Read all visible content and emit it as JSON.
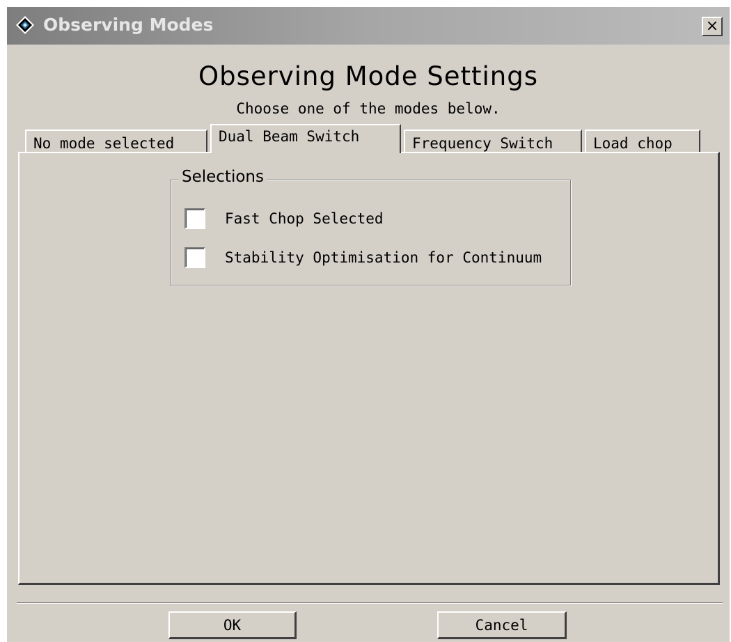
{
  "window": {
    "title": "Observing Modes",
    "close_label": "×"
  },
  "header": {
    "heading": "Observing Mode Settings",
    "subheading": "Choose one of the modes below."
  },
  "tabs": [
    {
      "label": "No mode selected",
      "active": false
    },
    {
      "label": "Dual Beam Switch",
      "active": true
    },
    {
      "label": "Frequency Switch",
      "active": false
    },
    {
      "label": "Load chop",
      "active": false
    }
  ],
  "selections": {
    "legend": "Selections",
    "options": [
      {
        "label": "Fast Chop Selected",
        "checked": false
      },
      {
        "label": "Stability Optimisation for Continuum",
        "checked": false
      }
    ]
  },
  "buttons": {
    "ok_label": "OK",
    "cancel_label": "Cancel"
  },
  "icons": {
    "app": "diamond-app-icon",
    "close": "close-icon"
  }
}
